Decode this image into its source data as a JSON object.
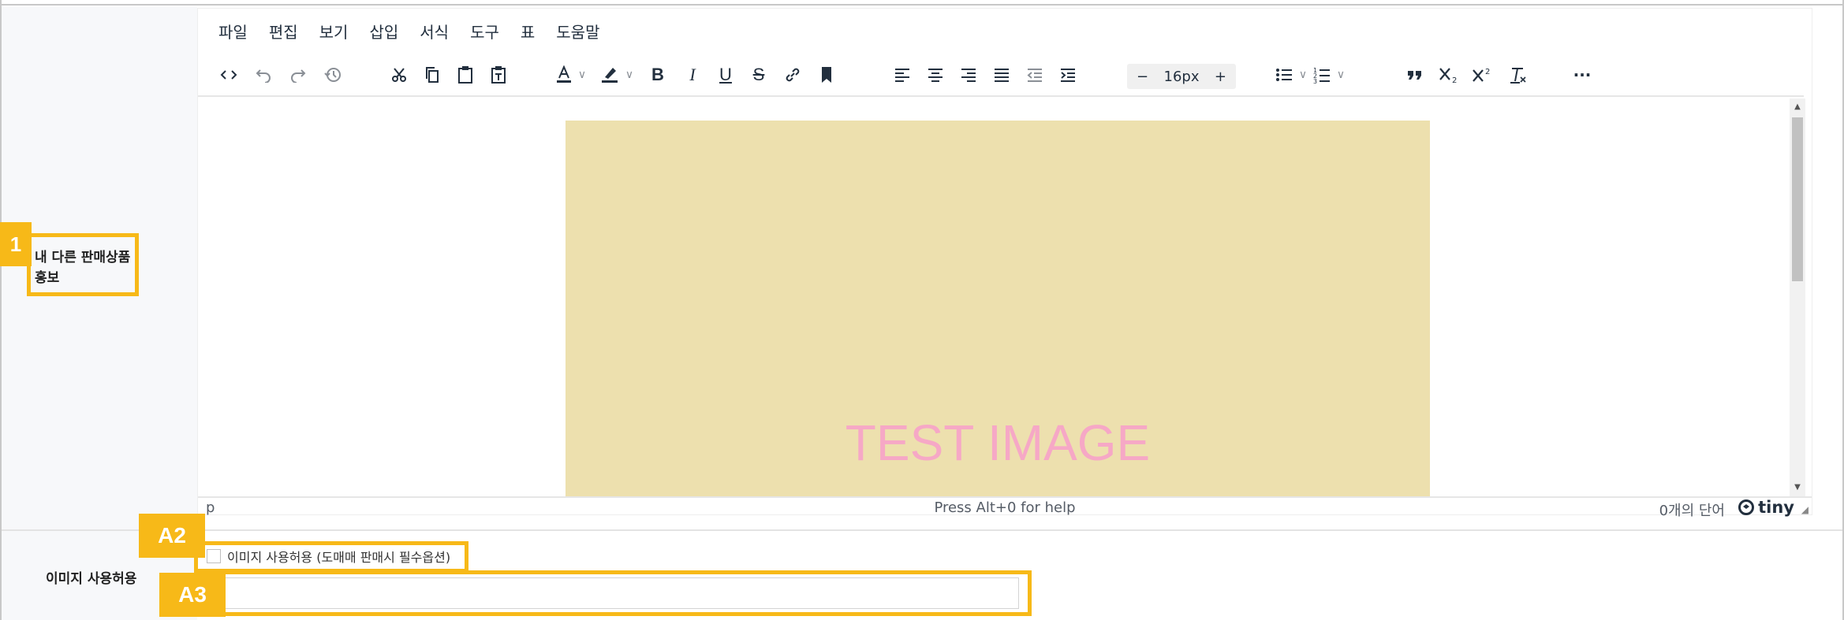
{
  "menubar": [
    "파일",
    "편집",
    "보기",
    "삽입",
    "서식",
    "도구",
    "표",
    "도움말"
  ],
  "toolbar": {
    "font_size": "16px",
    "minus": "−",
    "plus": "+",
    "bold": "B",
    "italic": "I",
    "underline": "U",
    "strike": "S",
    "more": "···"
  },
  "content": {
    "image_text": "TEST IMAGE",
    "image_bg": "#ede0ae",
    "image_text_color": "#f6a8c6"
  },
  "statusbar": {
    "path": "p",
    "help": "Press Alt+0 for help",
    "word_count": "0개의 단어",
    "brand": "tiny"
  },
  "form": {
    "promo_label_line1": "내 다른 판매상품",
    "promo_label_line2": "홍보",
    "image_permission_label": "이미지 사용허용",
    "checkbox_label": "이미지 사용허용 (도매매 판매시 필수옵션)",
    "text_value": ""
  },
  "annotations": {
    "badge_1": "1",
    "badge_a2": "A2",
    "badge_a3": "A3",
    "accent": "#f7b918"
  }
}
